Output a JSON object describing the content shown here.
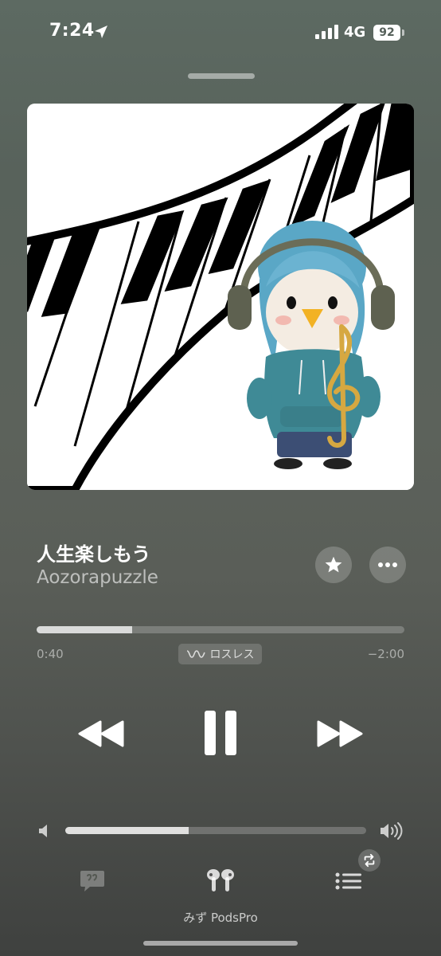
{
  "status_bar": {
    "time": "7:24",
    "network": "4G",
    "battery": "92"
  },
  "track": {
    "title": "人生楽しもう",
    "artist": "Aozorapuzzle"
  },
  "playback": {
    "elapsed": "0:40",
    "remaining": "−2:00",
    "progress_fraction": 0.26,
    "quality_badge": "ロスレス"
  },
  "volume": {
    "level_fraction": 0.41
  },
  "output": {
    "device": "みず PodsPro"
  },
  "icons": {
    "location": "location-arrow-icon",
    "signal": "cellular-signal-icon",
    "favorite": "star-icon",
    "more": "ellipsis-icon",
    "lossless": "lossless-wave-icon",
    "rewind": "rewind-icon",
    "pause": "pause-icon",
    "forward": "fast-forward-icon",
    "volume_low": "volume-low-icon",
    "volume_high": "volume-high-icon",
    "lyrics": "lyrics-quote-icon",
    "airpods": "airpods-icon",
    "queue": "queue-list-icon",
    "repeat": "repeat-icon"
  }
}
